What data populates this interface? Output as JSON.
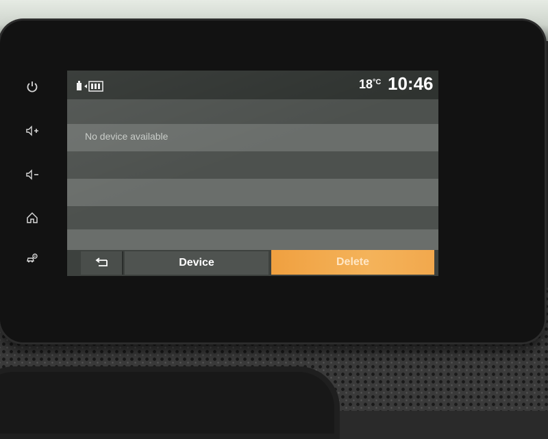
{
  "status_bar": {
    "battery_icon": "phone-battery-icon",
    "temperature": "18",
    "temperature_unit": "°C",
    "time": "10:46"
  },
  "side_keys": [
    {
      "icon": "power-icon"
    },
    {
      "icon": "volume-up-icon"
    },
    {
      "icon": "volume-down-icon"
    },
    {
      "icon": "home-icon"
    },
    {
      "icon": "car-settings-icon"
    }
  ],
  "device_list": {
    "empty_message": "No device available"
  },
  "bottom_bar": {
    "back_icon": "back-arrow-icon",
    "device_label": "Device",
    "delete_label": "Delete"
  },
  "colors": {
    "accent": "#f2a84d",
    "screen_bg": "#5b5e5b",
    "status_bar": "#2f3330"
  }
}
